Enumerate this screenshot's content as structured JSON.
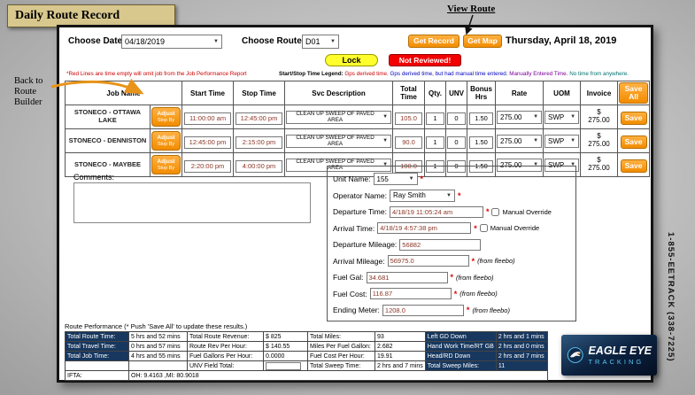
{
  "colors": {
    "accent_orange": "#f28c00",
    "navy": "#17375e",
    "lock_yellow": "#ffff2e",
    "alert_red": "#f20000",
    "time_text": "#8b3626",
    "title_bg": "#d8c88e",
    "logo_cyan": "#5bc8f5"
  },
  "annotations": {
    "title": "Daily Route Record",
    "view_route": "View Route",
    "back_to_builder_lines": [
      "Back to",
      "Route",
      "Builder"
    ],
    "phone": "1-855-EETRACK (338-7225)"
  },
  "logo": {
    "line1": "EAGLE EYE",
    "line2": "TRACKING"
  },
  "toolbar": {
    "choose_date_label": "Choose Date:",
    "date_value": "04/18/2019",
    "choose_route_label": "Choose Route:",
    "route_value": "D01",
    "get_record": "Get Record",
    "get_map": "Get Map",
    "date_display": "Thursday, April 18, 2019",
    "lock": "Lock",
    "not_reviewed": "Not Reviewed!",
    "red_note": "*Red Lines are time empty will omit job from the Job Performance Report",
    "legend_label": "Start/Stop Time Legend:",
    "legend": [
      {
        "text": "Gps derived time.",
        "color": "#cc0000"
      },
      {
        "text": "Gps derived time, but had manual time entered.",
        "color": "#0000bb"
      },
      {
        "text": "Manually Entered Time.",
        "color": "#7a0099"
      },
      {
        "text": "No time from anywhere.",
        "color": "#007070"
      }
    ]
  },
  "jobs_table": {
    "headers": [
      "Job Name",
      "Start Time",
      "Stop Time",
      "Svc Description",
      "Total Time",
      "Qty.",
      "UNV",
      "Bonus Hrs",
      "Rate",
      "UOM",
      "Invoice"
    ],
    "save_all": "Save All",
    "adjust": "Adjust",
    "adjust_sub": "Stop By",
    "save": "Save",
    "rows": [
      {
        "name": "STONECO - OTTAWA LAKE",
        "start": "11:00:00 am",
        "stop": "12:45:00 pm",
        "svc": "CLEAN UP SWEEP OF PAVED AREA",
        "total": "105.0",
        "qty": "1",
        "unv": "0",
        "bonus": "1.50",
        "rate": "275.00",
        "uom": "SWP",
        "cur": "$",
        "invoice": "275.00"
      },
      {
        "name": "STONECO - DENNISTON",
        "start": "12:45:00 pm",
        "stop": "2:15:00 pm",
        "svc": "CLEAN UP SWEEP OF PAVED AREA",
        "total": "90.0",
        "qty": "1",
        "unv": "0",
        "bonus": "1.50",
        "rate": "275.00",
        "uom": "SWP",
        "cur": "$",
        "invoice": "275.00"
      },
      {
        "name": "STONECO - MAYBEE",
        "start": "2:20:00 pm",
        "stop": "4:00:00 pm",
        "svc": "CLEAN UP SWEEP OF PAVED AREA",
        "total": "100.0",
        "qty": "1",
        "unv": "0",
        "bonus": "1.50",
        "rate": "275.00",
        "uom": "SWP",
        "cur": "$",
        "invoice": "275.00"
      }
    ]
  },
  "comments": {
    "label": "Comments:",
    "value": ""
  },
  "details": {
    "manual_override": "Manual Override",
    "from_fleebo": "(from fleebo)",
    "rows": [
      {
        "label": "Unit Name:",
        "value": "155"
      },
      {
        "label": "Operator Name:",
        "value": "Ray Smith"
      },
      {
        "label": "Departure Time:",
        "value": "4/18/19 11:05:24 am"
      },
      {
        "label": "Arrival Time:",
        "value": "4/18/19 4:57:38 pm"
      },
      {
        "label": "Departure Mileage:",
        "value": "56882"
      },
      {
        "label": "Arrival Mileage:",
        "value": "56975.0"
      },
      {
        "label": "Fuel Gal:",
        "value": "34.681"
      },
      {
        "label": "Fuel Cost:",
        "value": "116.87"
      },
      {
        "label": "Ending Meter:",
        "value": "1208.0"
      }
    ]
  },
  "summary": {
    "note": "Route Performance (* Push 'Save All' to update these results.)",
    "rows": [
      {
        "l1": "Total Route Time:",
        "v1": "5 hrs and 52 mins",
        "l2": "Total Route Revenue:",
        "v2": "$ 825",
        "l3": "Total Miles:",
        "v3": "93",
        "l4": "Left GD Down",
        "v4": "2 hrs and 1 mins"
      },
      {
        "l1": "Total Travel Time:",
        "v1": "0 hrs and 57 mins",
        "l2": "Route Rev Per Hour:",
        "v2": "$ 140.55",
        "l3": "Miles Per Fuel Gallon:",
        "v3": "2.682",
        "l4": "Hand Work Time/RT GB",
        "v4": "2 hrs and 0 mins"
      },
      {
        "l1": "Total Job Time:",
        "v1": "4 hrs and 55 mins",
        "l2": "Fuel Gallons Per Hour:",
        "v2": "0.0000",
        "l3": "Fuel Cost Per Hour:",
        "v3": "19.91",
        "l4": "Head/RD Down",
        "v4": "2 hrs and 7 mins"
      },
      {
        "l1": "",
        "v1": "",
        "l2": "UNV Field Total:",
        "v2": "",
        "l3": "Total Sweep Time:",
        "v3": "2 hrs and 7 mins",
        "l4": "Total Sweep Miles:",
        "v4": "11"
      },
      {
        "l1": "IFTA:",
        "v1": "OH: 9.4163 ,MI: 80.9018"
      }
    ]
  }
}
